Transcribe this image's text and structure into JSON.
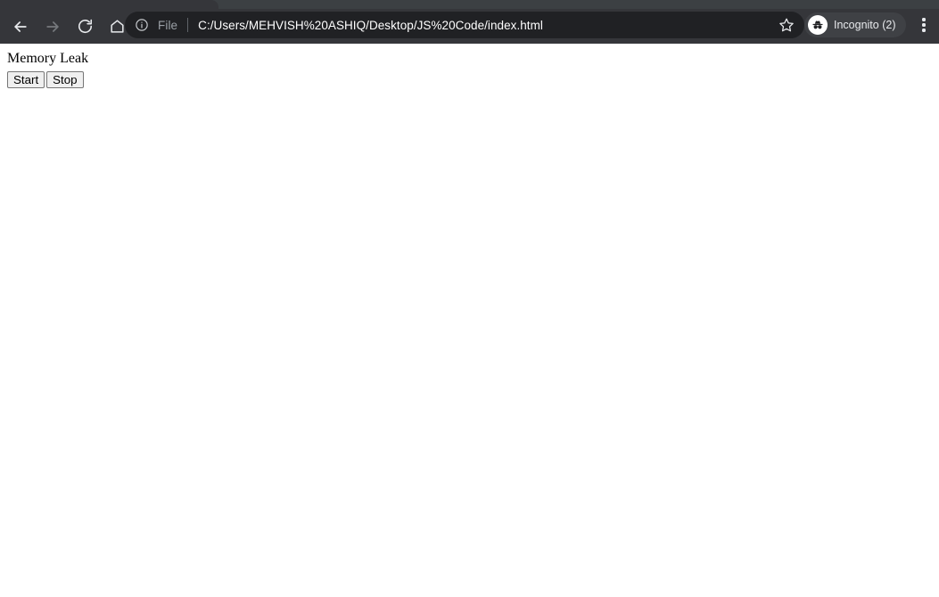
{
  "browser": {
    "tab": {
      "title": ""
    },
    "nav": {
      "back_label": "Back",
      "forward_label": "Forward",
      "reload_label": "Reload",
      "home_label": "Home"
    },
    "omnibox": {
      "info_icon": "info-circle-icon",
      "scheme_label": "File",
      "url": "C:/Users/MEHVISH%20ASHIQ/Desktop/JS%20Code/index.html",
      "star_icon": "bookmark-star-icon"
    },
    "profile": {
      "icon": "incognito-icon",
      "label": "Incognito (2)"
    },
    "menu": {
      "icon": "three-dots-vertical-icon",
      "label": "Customize and control Google Chrome"
    },
    "colors": {
      "toolbar_bg": "#35363a",
      "tabstrip_bg": "#3c4043",
      "omnibox_bg": "#202124",
      "icon_fg": "#e8eaed",
      "muted_fg": "#9aa0a6",
      "page_bg": "#ffffff"
    }
  },
  "page": {
    "heading": "Memory Leak",
    "buttons": [
      {
        "label": "Start",
        "name": "start-button"
      },
      {
        "label": "Stop",
        "name": "stop-button"
      }
    ]
  }
}
